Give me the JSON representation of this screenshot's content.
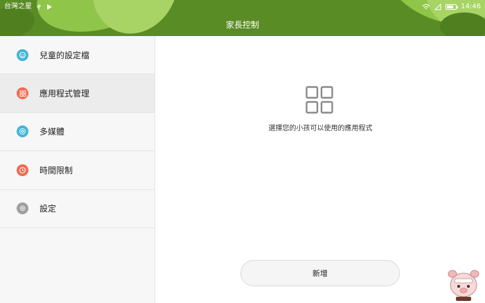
{
  "status_bar": {
    "carrier": "台灣之星",
    "left_icons": [
      "usb-icon",
      "play-icon"
    ],
    "right_icons": [
      "wifi-icon",
      "signal-icon",
      "battery-icon"
    ],
    "time": "14:46"
  },
  "header": {
    "title": "家長控制"
  },
  "sidebar": {
    "items": [
      {
        "label": "兒童的設定檔",
        "icon": "profile-icon",
        "color": "#3fb6d6"
      },
      {
        "label": "應用程式管理",
        "icon": "apps-icon",
        "color": "#f06a4f",
        "active": true
      },
      {
        "label": "多媒體",
        "icon": "media-icon",
        "color": "#3fb6d6"
      },
      {
        "label": "時間限制",
        "icon": "clock-icon",
        "color": "#f06a4f"
      },
      {
        "label": "設定",
        "icon": "gear-icon",
        "color": "#9e9e9e"
      }
    ]
  },
  "main": {
    "icon": "grid-icon",
    "description": "選擇您的小孩可以使用的應用程式",
    "add_button_label": "新增"
  },
  "colors": {
    "header_green": "#5a8c25",
    "leaf_light": "#a8d365",
    "sidebar_bg": "#f7f7f7",
    "active_bg": "#ececec"
  }
}
